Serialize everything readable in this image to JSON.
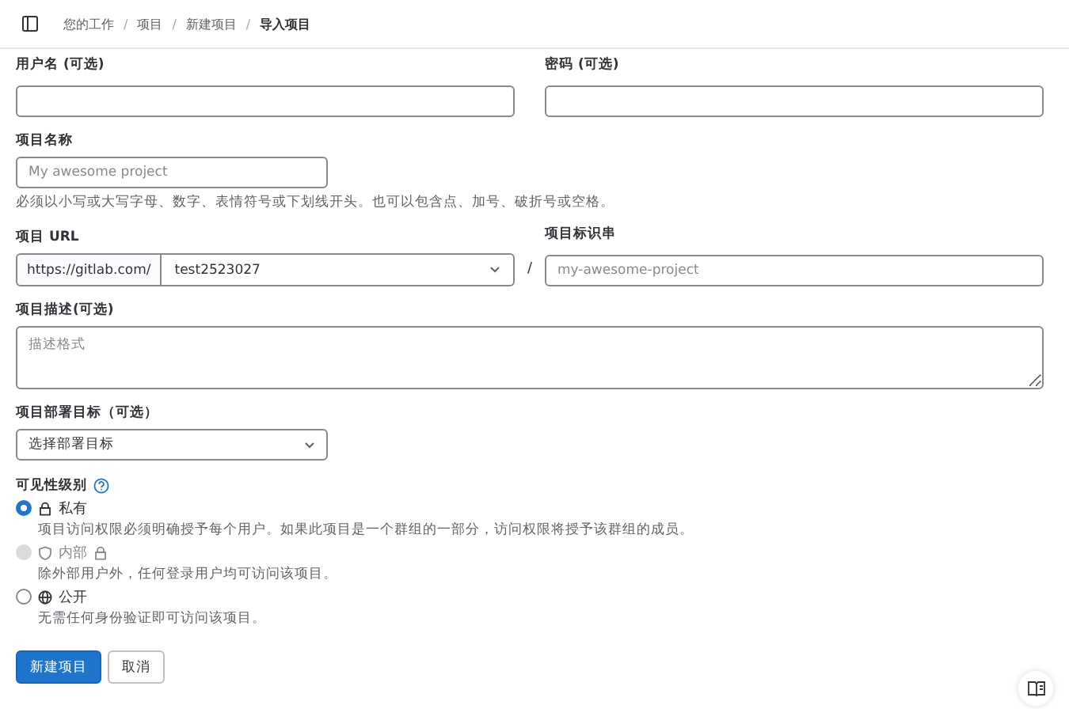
{
  "breadcrumb": [
    {
      "label": "您的工作",
      "current": false
    },
    {
      "separator": "/",
      "label": "项目",
      "current": false
    },
    {
      "separator": "/",
      "label": "新建项目",
      "current": false
    },
    {
      "separator": "/",
      "label": "导入项目",
      "current": true
    }
  ],
  "credentials": [
    {
      "label": "用户名 (可选)"
    },
    {
      "label": "密码 (可选)"
    }
  ],
  "project_name": {
    "label": "项目名称",
    "placeholder": "My awesome project",
    "help": "必须以小写或大写字母、数字、表情符号或下划线开头。也可以包含点、加号、破折号或空格。"
  },
  "project_url": {
    "label": "项目 URL",
    "prefix": "https://gitlab.com/",
    "namespace": "test2523027",
    "separator": "/"
  },
  "project_slug": {
    "label": "项目标识串",
    "placeholder": "my-awesome-project"
  },
  "description": {
    "label": "项目描述(可选)",
    "placeholder": "描述格式"
  },
  "deployment_target": {
    "label": "项目部署目标（可选）",
    "value": "选择部署目标"
  },
  "visibility": {
    "label": "可见性级别",
    "options": [
      {
        "kind": "private",
        "label": "私有",
        "description": "项目访问权限必须明确授予每个用户。如果此项目是一个群组的一部分，访问权限将授予该群组的成员。",
        "selected": true,
        "disabled": false
      },
      {
        "kind": "internal",
        "label": "内部",
        "description": "除外部用户外，任何登录用户均可访问该项目。",
        "selected": false,
        "disabled": true
      },
      {
        "kind": "public",
        "label": "公开",
        "description": "无需任何身份验证即可访问该项目。",
        "selected": false,
        "disabled": false
      }
    ]
  },
  "buttons": [
    {
      "kind": "primary",
      "label": "新建项目"
    },
    {
      "kind": "default",
      "label": "取消"
    }
  ]
}
